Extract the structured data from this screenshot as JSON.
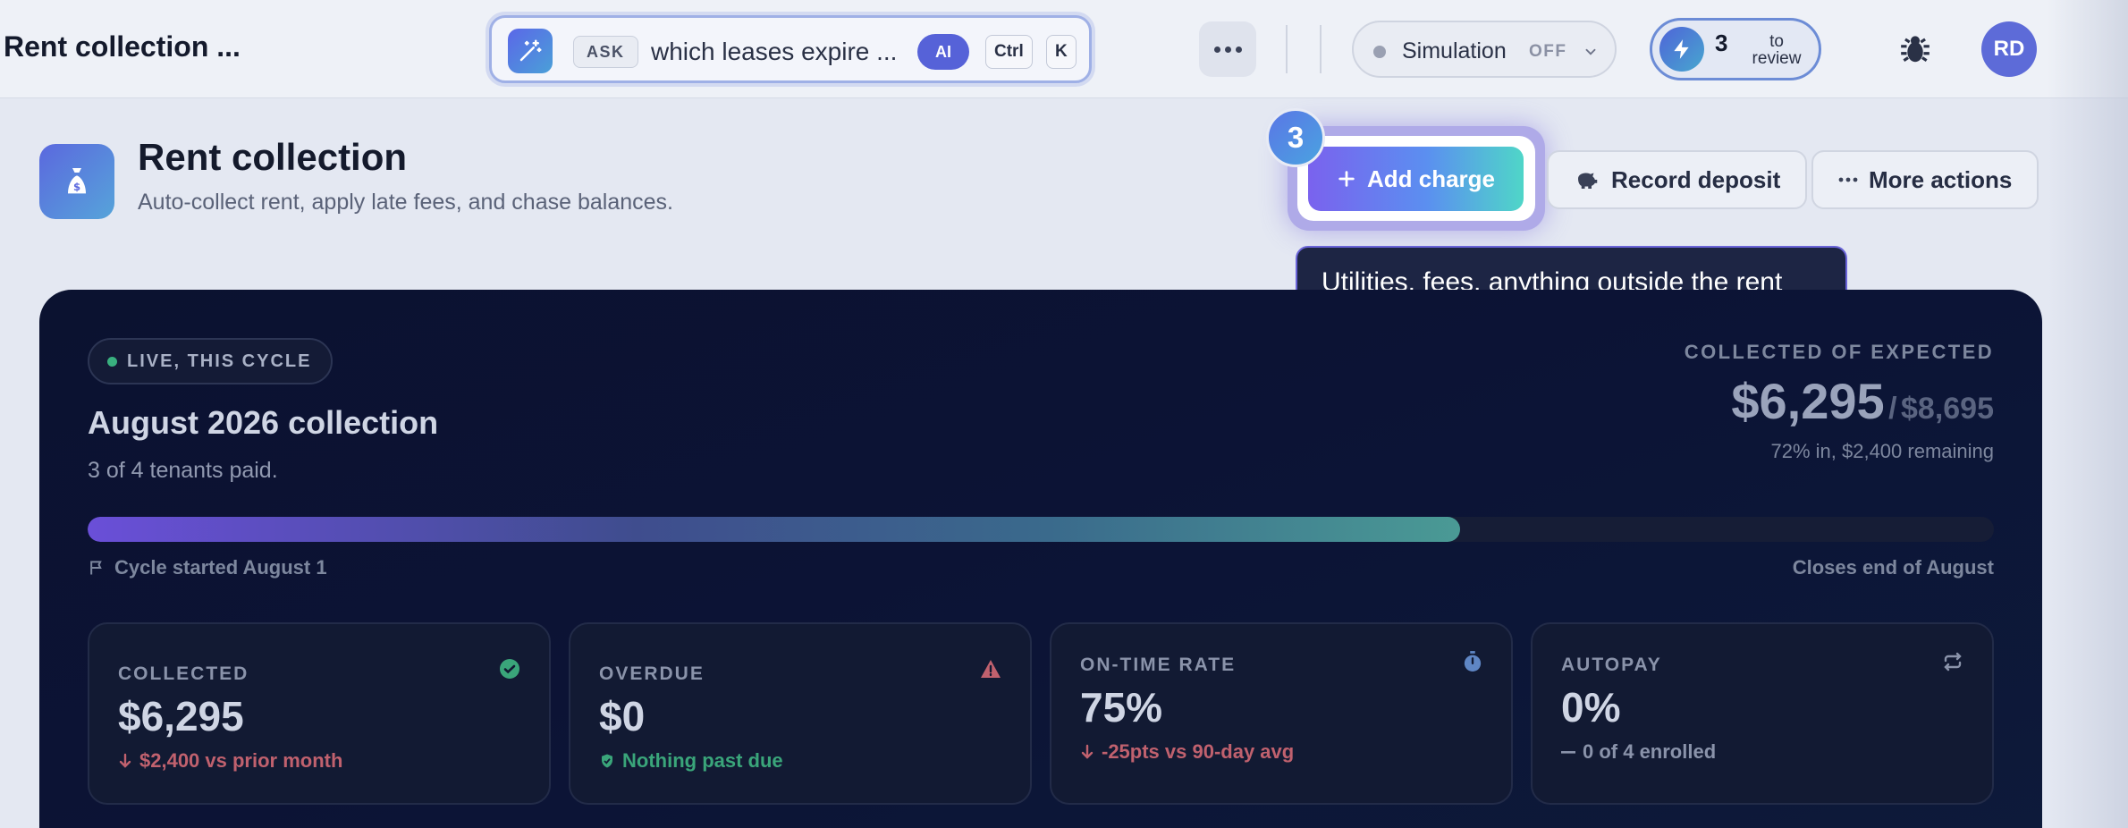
{
  "topbar": {
    "app_title": "Rent collection ...",
    "ask": {
      "chip": "ASK",
      "query": "which leases expire ...",
      "ai_chip": "AI",
      "shortcut_keys": [
        "Ctrl",
        "K"
      ]
    },
    "simulation": {
      "label": "Simulation",
      "state": "OFF"
    },
    "review": {
      "count": "3",
      "label": "to review"
    },
    "avatar_initials": "RD"
  },
  "header": {
    "title": "Rent collection",
    "subtitle": "Auto-collect rent, apply late fees, and chase balances.",
    "add_charge_label": "Add charge",
    "step_badge": "3",
    "tooltip": "Utilities, fees, anything outside the rent",
    "record_deposit_label": "Record deposit",
    "more_actions_label": "More actions"
  },
  "hero": {
    "live_label": "LIVE, THIS CYCLE",
    "title": "August 2026 collection",
    "subtitle": "3 of 4 tenants paid.",
    "collected_of_expected_label": "COLLECTED OF EXPECTED",
    "collected_amount": "$6,295",
    "expected_separator": "/",
    "expected_amount": "$8,695",
    "progress_note": "72% in, $2,400 remaining",
    "progress_fraction": 0.72,
    "cycle_start": "Cycle started August 1",
    "cycle_end": "Closes end of August"
  },
  "stats": [
    {
      "label": "COLLECTED",
      "value": "$6,295",
      "note": "$2,400 vs prior month",
      "note_color": "#c0616e",
      "icon": "check-circle-icon"
    },
    {
      "label": "OVERDUE",
      "value": "$0",
      "note": "Nothing past due",
      "note_color": "#3aa57a",
      "icon": "warning-icon"
    },
    {
      "label": "ON-TIME RATE",
      "value": "75%",
      "note": "-25pts vs 90-day avg",
      "note_color": "#c0616e",
      "icon": "stopwatch-icon"
    },
    {
      "label": "AUTOPAY",
      "value": "0%",
      "note": "0 of 4 enrolled",
      "note_color": "#8a93aa",
      "icon": "repeat-icon"
    }
  ],
  "colors": {
    "accent": "#5b62e0",
    "hero_bg": "#0b1230",
    "positive": "#3aa57a",
    "negative": "#c0616e"
  }
}
